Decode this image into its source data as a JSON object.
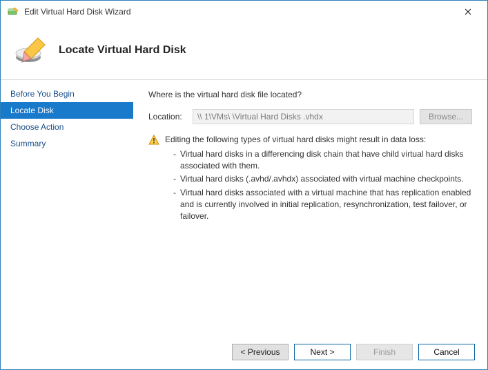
{
  "window": {
    "title": "Edit Virtual Hard Disk Wizard"
  },
  "header": {
    "title": "Locate Virtual Hard Disk"
  },
  "sidebar": {
    "items": [
      {
        "label": "Before You Begin",
        "selected": false
      },
      {
        "label": "Locate Disk",
        "selected": true
      },
      {
        "label": "Choose Action",
        "selected": false
      },
      {
        "label": "Summary",
        "selected": false
      }
    ]
  },
  "content": {
    "question": "Where is the virtual hard disk file located?",
    "location_label": "Location:",
    "location_value": "\\\\            1\\VMs\\        \\Virtual Hard Disks          .vhdx",
    "browse_label": "Browse...",
    "warning_heading": "Editing the following types of virtual hard disks might result in data loss:",
    "bullets": [
      "Virtual hard disks in a differencing disk chain that have child virtual hard disks associated with them.",
      "Virtual hard disks (.avhd/.avhdx) associated with virtual machine checkpoints.",
      "Virtual hard disks associated with a virtual machine that has replication enabled and is currently involved in initial replication, resynchronization, test failover, or failover."
    ]
  },
  "footer": {
    "previous": "< Previous",
    "next": "Next >",
    "finish": "Finish",
    "cancel": "Cancel"
  }
}
